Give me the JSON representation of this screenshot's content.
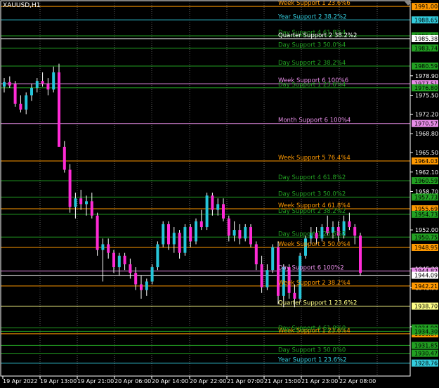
{
  "window": {
    "symbol": "XAUUSD,H1"
  },
  "colors": {
    "background": "#000000",
    "grid": "#5a5a5a",
    "frame": "#ffffff",
    "bull": "#26c6da",
    "bear": "#ff2bd6",
    "wick": "#ffffff"
  },
  "price_axis": {
    "min": 1926.5,
    "max": 1992.0
  },
  "time_labels": [
    "19 Apr 2022",
    "19 Apr 13:00",
    "19 Apr 21:00",
    "20 Apr 06:00",
    "20 Apr 14:00",
    "20 Apr 22:00",
    "21 Apr 07:00",
    "21 Apr 15:00",
    "21 Apr 23:00",
    "22 Apr 08:00"
  ],
  "axis_ticks": [
    {
      "text": "1978.90",
      "price": 1978.9
    },
    {
      "text": "1975.50",
      "price": 1975.5
    },
    {
      "text": "1972.20",
      "price": 1972.2
    },
    {
      "text": "1968.80",
      "price": 1968.8
    },
    {
      "text": "1965.50",
      "price": 1965.5
    },
    {
      "text": "1962.10",
      "price": 1962.1
    },
    {
      "text": "1958.70",
      "price": 1958.7
    },
    {
      "text": "1952.00",
      "price": 1952.0
    },
    {
      "text": "1945.20",
      "price": 1945.2
    },
    {
      "text": "1941.90",
      "price": 1941.9
    },
    {
      "text": "1935.10",
      "price": 1935.1
    }
  ],
  "levels": [
    {
      "label": "Week Support 1 23.6%6",
      "price_label": "1991.00",
      "price": 1991.0,
      "color": "#ff9900"
    },
    {
      "label": "Day Support 4 61.8%4",
      "price_label": "1985.86",
      "price": 1985.86,
      "color": "#22a022"
    },
    {
      "label": "Year Support 2 38.2%2",
      "price_label": "1988.65",
      "price": 1988.65,
      "color": "#33ccdd"
    },
    {
      "label": "Quarter Support 2 38.2%2",
      "price_label": "1985.38",
      "price": 1985.38,
      "color": "#ffffff"
    },
    {
      "label": "Day Support 3 50.0%4",
      "price_label": "1983.74",
      "price": 1983.74,
      "color": "#22a022"
    },
    {
      "label": "Day Support 2 38.2%4",
      "price_label": "1980.59",
      "price": 1980.59,
      "color": "#22a022"
    },
    {
      "label": "Week Support 6 100%6",
      "price_label": "1977.51",
      "price": 1977.51,
      "color": "#e88ee8"
    },
    {
      "label": "Day Support 1 23.6%4",
      "price_label": "1976.80",
      "price": 1976.8,
      "color": "#22a022"
    },
    {
      "label": "Month Support 6 100%4",
      "price_label": "1970.57",
      "price": 1970.57,
      "color": "#e88ee8"
    },
    {
      "label": "Week Support 5 76.4%4",
      "price_label": "1964.03",
      "price": 1964.03,
      "color": "#ff9900"
    },
    {
      "label": "Day Support 4 61.8%2",
      "price_label": "1960.59",
      "price": 1960.59,
      "color": "#22a022"
    },
    {
      "label": "Day Support 3 50.0%2",
      "price_label": "1957.73",
      "price": 1957.73,
      "color": "#22a022"
    },
    {
      "label": "Week Support 4 61.8%4",
      "price_label": "1955.69",
      "price": 1955.69,
      "color": "#ff9900"
    },
    {
      "label": "Day Support 2 38.2%2",
      "price_label": "1954.73",
      "price": 1954.73,
      "color": "#22a022"
    },
    {
      "label": "Day Support 1 23.6%2",
      "price_label": "1950.75",
      "price": 1950.75,
      "color": "#22a022"
    },
    {
      "label": "Week Support 3 50.0%4",
      "price_label": "1948.95",
      "price": 1948.95,
      "color": "#ff9900"
    },
    {
      "label": "Day Support 6 100%2",
      "price_label": "1944.82",
      "price": 1944.82,
      "color": "#e88ee8"
    },
    {
      "label": "",
      "price_label": "1944.09",
      "price": 1944.09,
      "color": "#ffffff"
    },
    {
      "label": "Week Support 2 38.2%4",
      "price_label": "1942.21",
      "price": 1942.21,
      "color": "#ff9900"
    },
    {
      "label": "Quarter Support 1 23.6%2",
      "price_label": "1938.70",
      "price": 1938.7,
      "color": "#ffff88"
    },
    {
      "label": "",
      "price_label": "1934.90",
      "price": 1934.9,
      "color": "#22a022"
    },
    {
      "label": "Week Support 1 23.6%4",
      "price_label": "1933.87",
      "price": 1933.87,
      "color": "#ff9900"
    },
    {
      "label": "Day Support 4 61.0%0",
      "price_label": "1934.30",
      "price": 1934.3,
      "color": "#22a022"
    },
    {
      "label": "",
      "price_label": "1931.85",
      "price": 1931.85,
      "color": "#22a022"
    },
    {
      "label": "Day Support 3 50.0%0",
      "price_label": "1930.47",
      "price": 1930.47,
      "color": "#22a022"
    },
    {
      "label": "Year Support 1 23.6%2",
      "price_label": "1928.76",
      "price": 1928.76,
      "color": "#33ccdd"
    }
  ],
  "candles": [
    [
      1977.0,
      1978.5,
      1976.0,
      1977.8
    ],
    [
      1977.8,
      1978.8,
      1976.8,
      1977.2
    ],
    [
      1977.5,
      1978.0,
      1973.5,
      1974.0
    ],
    [
      1974.0,
      1975.5,
      1972.5,
      1973.0
    ],
    [
      1973.0,
      1976.0,
      1972.2,
      1975.5
    ],
    [
      1975.5,
      1977.5,
      1974.5,
      1976.8
    ],
    [
      1976.8,
      1978.5,
      1976.0,
      1978.0
    ],
    [
      1978.0,
      1979.5,
      1977.0,
      1977.5
    ],
    [
      1977.5,
      1978.5,
      1975.5,
      1976.5
    ],
    [
      1976.5,
      1980.5,
      1976.0,
      1979.5
    ],
    [
      1979.5,
      1981.0,
      1968.0,
      1966.5
    ],
    [
      1966.5,
      1967.5,
      1962.0,
      1962.5
    ],
    [
      1962.5,
      1963.5,
      1955.0,
      1956.0
    ],
    [
      1956.0,
      1958.5,
      1954.0,
      1957.5
    ],
    [
      1957.5,
      1959.0,
      1955.5,
      1956.5
    ],
    [
      1956.5,
      1958.0,
      1954.5,
      1957.0
    ],
    [
      1957.0,
      1958.5,
      1954.0,
      1954.5
    ],
    [
      1954.5,
      1955.0,
      1947.5,
      1948.5
    ],
    [
      1948.5,
      1950.5,
      1943.0,
      1949.5
    ],
    [
      1949.5,
      1950.5,
      1947.0,
      1948.0
    ],
    [
      1948.0,
      1948.5,
      1944.5,
      1945.5
    ],
    [
      1945.5,
      1948.0,
      1944.0,
      1947.5
    ],
    [
      1947.5,
      1948.0,
      1945.0,
      1946.0
    ],
    [
      1946.0,
      1947.0,
      1943.5,
      1944.5
    ],
    [
      1944.5,
      1945.5,
      1941.5,
      1942.5
    ],
    [
      1942.5,
      1944.0,
      1940.0,
      1941.5
    ],
    [
      1941.5,
      1943.5,
      1940.5,
      1943.0
    ],
    [
      1943.0,
      1946.0,
      1942.5,
      1945.5
    ],
    [
      1945.5,
      1950.0,
      1945.0,
      1949.5
    ],
    [
      1949.5,
      1953.5,
      1949.0,
      1953.0
    ],
    [
      1953.0,
      1953.5,
      1948.5,
      1949.5
    ],
    [
      1949.5,
      1952.5,
      1948.0,
      1951.5
    ],
    [
      1951.5,
      1952.0,
      1947.0,
      1948.0
    ],
    [
      1948.0,
      1953.0,
      1947.5,
      1952.5
    ],
    [
      1952.5,
      1953.0,
      1949.0,
      1950.0
    ],
    [
      1950.0,
      1954.0,
      1949.5,
      1953.5
    ],
    [
      1953.5,
      1955.5,
      1952.0,
      1952.5
    ],
    [
      1952.5,
      1958.5,
      1952.0,
      1958.0
    ],
    [
      1958.0,
      1958.5,
      1954.5,
      1955.5
    ],
    [
      1955.5,
      1957.5,
      1954.5,
      1956.5
    ],
    [
      1956.5,
      1957.5,
      1953.5,
      1954.0
    ],
    [
      1954.0,
      1954.5,
      1950.0,
      1951.0
    ],
    [
      1951.0,
      1953.5,
      1950.0,
      1952.0
    ],
    [
      1952.0,
      1953.0,
      1949.5,
      1950.5
    ],
    [
      1950.5,
      1953.0,
      1950.0,
      1952.5
    ],
    [
      1952.5,
      1953.0,
      1949.0,
      1949.5
    ],
    [
      1949.5,
      1950.0,
      1945.0,
      1946.0
    ],
    [
      1946.0,
      1947.5,
      1941.0,
      1942.0
    ],
    [
      1942.0,
      1946.0,
      1941.5,
      1945.0
    ],
    [
      1945.0,
      1949.5,
      1944.5,
      1949.0
    ],
    [
      1949.0,
      1950.0,
      1939.0,
      1940.5
    ],
    [
      1940.5,
      1946.0,
      1938.5,
      1945.5
    ],
    [
      1945.5,
      1946.0,
      1940.0,
      1941.0
    ],
    [
      1941.0,
      1942.5,
      1938.5,
      1940.0
    ],
    [
      1940.0,
      1948.0,
      1939.5,
      1947.5
    ],
    [
      1947.5,
      1951.0,
      1947.0,
      1950.5
    ],
    [
      1950.5,
      1952.5,
      1949.5,
      1951.5
    ],
    [
      1951.5,
      1952.5,
      1949.5,
      1950.5
    ],
    [
      1950.5,
      1953.0,
      1950.0,
      1952.5
    ],
    [
      1952.5,
      1954.5,
      1951.0,
      1951.5
    ],
    [
      1951.5,
      1953.5,
      1950.5,
      1952.5
    ],
    [
      1952.5,
      1953.5,
      1950.0,
      1951.0
    ],
    [
      1951.0,
      1954.5,
      1950.5,
      1953.5
    ],
    [
      1953.5,
      1955.0,
      1952.0,
      1952.5
    ],
    [
      1952.5,
      1953.0,
      1949.5,
      1951.0
    ],
    [
      1951.0,
      1951.5,
      1944.0,
      1944.5
    ]
  ]
}
